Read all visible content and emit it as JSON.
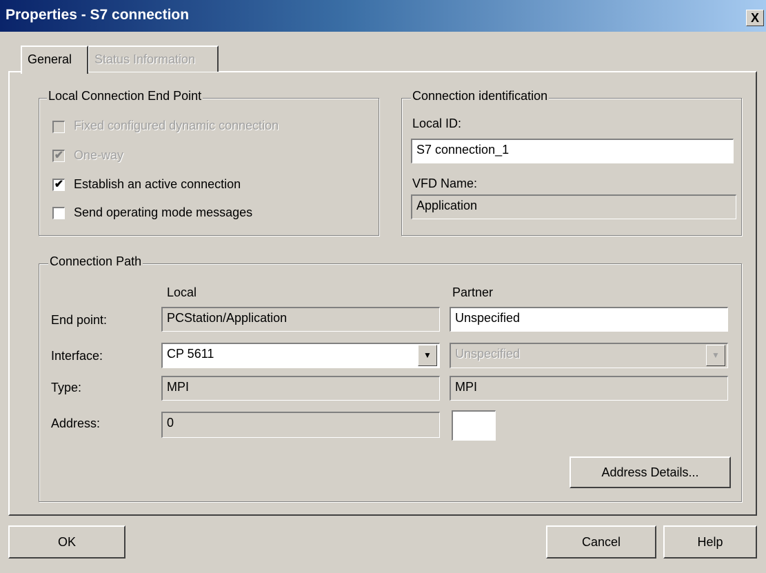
{
  "window": {
    "title": "Properties - S7 connection",
    "close_label": "X"
  },
  "tabs": [
    {
      "label": "General",
      "active": true
    },
    {
      "label": "Status Information",
      "active": false
    }
  ],
  "local_endpoint": {
    "legend": "Local Connection End Point",
    "checkboxes": [
      {
        "label": "Fixed configured dynamic connection",
        "checked": false,
        "disabled": true
      },
      {
        "label": "One-way",
        "checked": true,
        "disabled": true
      },
      {
        "label": "Establish an active connection",
        "checked": true,
        "disabled": false
      },
      {
        "label": "Send operating mode messages",
        "checked": false,
        "disabled": false
      }
    ]
  },
  "connection_id": {
    "legend": "Connection identification",
    "local_id_label": "Local ID:",
    "local_id_value": "S7 connection_1",
    "vfd_label": "VFD Name:",
    "vfd_value": "Application"
  },
  "connection_path": {
    "legend": "Connection Path",
    "local_header": "Local",
    "partner_header": "Partner",
    "rows": {
      "end_point": {
        "label": "End point:",
        "local": "PCStation/Application",
        "partner": "Unspecified"
      },
      "interface": {
        "label": "Interface:",
        "local": "CP 5611",
        "partner": "Unspecified"
      },
      "type": {
        "label": "Type:",
        "local": "MPI",
        "partner": "MPI"
      },
      "address": {
        "label": "Address:",
        "local": "0",
        "partner": ""
      }
    },
    "address_details_label": "Address Details..."
  },
  "buttons": {
    "ok": "OK",
    "cancel": "Cancel",
    "help": "Help"
  },
  "colors": {
    "face": "#d4d0c8",
    "title_start": "#0a246a",
    "title_end": "#a6caf0"
  }
}
